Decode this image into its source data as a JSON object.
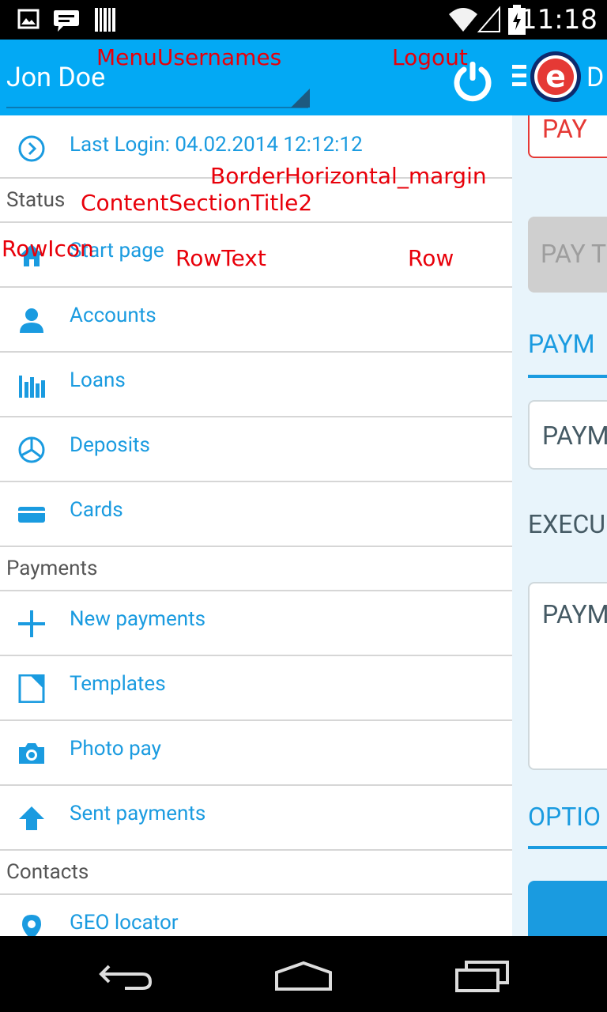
{
  "status_bar": {
    "time": "11:18",
    "icons": [
      "image-icon",
      "chat-icon",
      "barcode-icon",
      "wifi-icon",
      "signal-icon",
      "battery-icon"
    ]
  },
  "header": {
    "username": "Jon Doe",
    "app_title_partial": "D",
    "colors": {
      "header_bg": "#03a9f4",
      "accent": "#1a9be0"
    }
  },
  "drawer": {
    "last_login": "Last Login: 04.02.2014 12:12:12",
    "status_section": "Status",
    "status_items": [
      {
        "label": "Start page",
        "icon": "home-icon"
      },
      {
        "label": "Accounts",
        "icon": "person-icon"
      },
      {
        "label": "Loans",
        "icon": "bar-chart-icon"
      },
      {
        "label": "Deposits",
        "icon": "pie-chart-icon"
      },
      {
        "label": "Cards",
        "icon": "card-icon"
      }
    ],
    "payments_section": "Payments",
    "payments_items": [
      {
        "label": "New payments",
        "icon": "plus-icon"
      },
      {
        "label": "Templates",
        "icon": "template-icon"
      },
      {
        "label": "Photo pay",
        "icon": "camera-icon"
      },
      {
        "label": "Sent payments",
        "icon": "arrow-up-icon"
      }
    ],
    "contacts_section": "Contacts",
    "contacts_items": [
      {
        "label": "GEO locator",
        "icon": "location-pin-icon"
      }
    ]
  },
  "background": {
    "pay_button_1": "PAY",
    "pay_button_2": "PAY T",
    "payment_header": "PAYM",
    "payment_field": "PAYM",
    "execution_label": "EXECU",
    "payment_textarea": "PAYM",
    "options_header": "OPTIO"
  },
  "debug_labels": {
    "menu_usernames": "MenuUsernames",
    "logout": "Logout",
    "border_horizontal_margin": "BorderHorizontal_margin",
    "content_section_title": "ContentSectionTitle2",
    "row_icon": "RowIcon",
    "row_text": "RowText",
    "row": "Row"
  }
}
